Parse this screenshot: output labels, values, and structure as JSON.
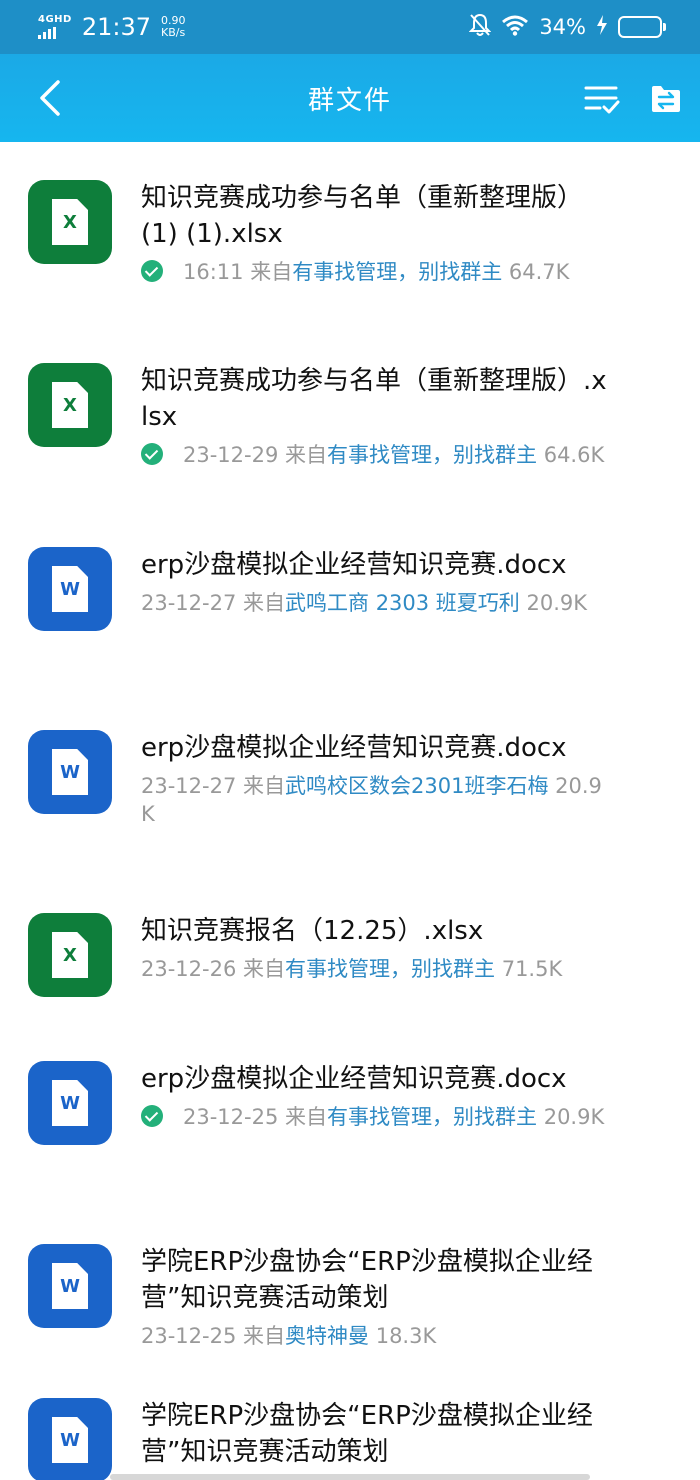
{
  "status_bar": {
    "network": "4GHD",
    "time": "21:37",
    "speed_value": "0.90",
    "speed_unit": "KB/s",
    "battery_percent": "34%",
    "battery_level": 0.34
  },
  "header": {
    "title": "群文件"
  },
  "colors": {
    "header": "#16b6ef",
    "status_bar": "#1e8fc7",
    "xlsx": "#0e7e3b",
    "docx": "#1b64c9",
    "sender_link": "#2f8ac4",
    "check": "#23b07a"
  },
  "files": [
    {
      "name": "知识竞赛成功参与名单（重新整理版） (1) (1).xlsx",
      "type": "xlsx",
      "icon_letter": "X",
      "downloaded": true,
      "time": "16:11",
      "from_label": "来自",
      "sender": "有事找管理，别找群主",
      "size": "64.7K"
    },
    {
      "name": "知识竞赛成功参与名单（重新整理版）.xlsx",
      "type": "xlsx",
      "icon_letter": "X",
      "downloaded": true,
      "time": "23-12-29",
      "from_label": "来自",
      "sender": "有事找管理，别找群主",
      "size": "64.6K"
    },
    {
      "name": "erp沙盘模拟企业经营知识竞赛.docx",
      "type": "docx",
      "icon_letter": "W",
      "downloaded": false,
      "time": "23-12-27",
      "from_label": "来自",
      "sender": "武鸣工商 2303 班夏巧利",
      "size": "20.9K"
    },
    {
      "name": "erp沙盘模拟企业经营知识竞赛.docx",
      "type": "docx",
      "icon_letter": "W",
      "downloaded": false,
      "time": "23-12-27",
      "from_label": "来自",
      "sender": "武鸣校区数会2301班李石梅",
      "size": "20.9K"
    },
    {
      "name": "知识竞赛报名（12.25）.xlsx",
      "type": "xlsx",
      "icon_letter": "X",
      "downloaded": false,
      "time": "23-12-26",
      "from_label": "来自",
      "sender": "有事找管理，别找群主",
      "size": "71.5K"
    },
    {
      "name": "erp沙盘模拟企业经营知识竞赛.docx",
      "type": "docx",
      "icon_letter": "W",
      "downloaded": true,
      "time": "23-12-25",
      "from_label": "来自",
      "sender": "有事找管理，别找群主",
      "size": "20.9K"
    },
    {
      "name": "学院ERP沙盘协会“ERP沙盘模拟企业经营”知识竞赛活动策划",
      "type": "docx",
      "icon_letter": "W",
      "downloaded": false,
      "time": "23-12-25",
      "from_label": "来自",
      "sender": "奥特神曼",
      "size": "18.3K"
    },
    {
      "name": "学院ERP沙盘协会“ERP沙盘模拟企业经营”知识竞赛活动策划",
      "type": "docx",
      "icon_letter": "W",
      "downloaded": false,
      "time": "",
      "from_label": "",
      "sender": "",
      "size": ""
    }
  ]
}
